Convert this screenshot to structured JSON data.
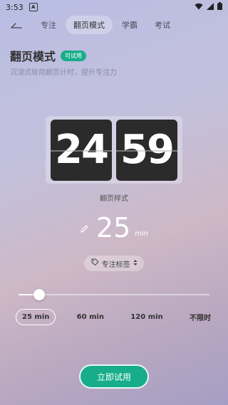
{
  "status_bar": {
    "time": "3:53",
    "badge": "A"
  },
  "nav": {
    "tabs": [
      {
        "label": "专注"
      },
      {
        "label": "翻页模式"
      },
      {
        "label": "学霸"
      },
      {
        "label": "考试"
      }
    ],
    "active_tab": 1
  },
  "mode": {
    "title": "翻页模式",
    "badge": "可试用",
    "description": "沉浸式极简翻页计时，提升专注力"
  },
  "clock": {
    "hours": "24",
    "minutes": "59",
    "style_label": "翻页样式"
  },
  "duration": {
    "value": "25",
    "unit": "min"
  },
  "tag": {
    "label": "专注标签"
  },
  "slider": {
    "value_fraction": 0.11
  },
  "presets": [
    {
      "label": "25 min",
      "active": true
    },
    {
      "label": "60 min",
      "active": false
    },
    {
      "label": "120 min",
      "active": false
    },
    {
      "label": "不限时",
      "active": false
    }
  ],
  "cta": {
    "label": "立即试用"
  },
  "colors": {
    "accent": "#17ad8a",
    "flip_card": "#2b2b2b"
  }
}
